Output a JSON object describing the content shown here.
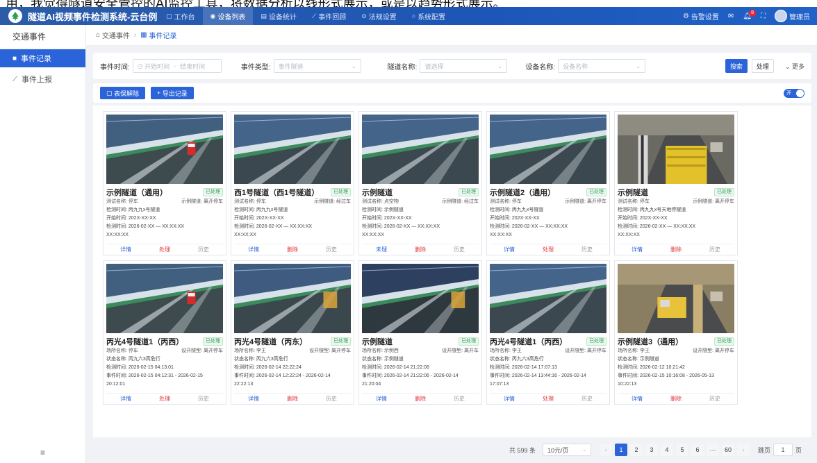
{
  "caption": "用，我觉得隧道安全管控的AI监控工具，将数据分析以线形式展示，或是以趋势形式展示。",
  "header": {
    "title": "隧道AI视频事件检测系统-云台例",
    "nav": [
      {
        "icon": "▢",
        "label": "工作台"
      },
      {
        "icon": "◉",
        "label": "设备列表"
      },
      {
        "icon": "▤",
        "label": "设备统计"
      },
      {
        "icon": "⟋",
        "label": "事件回顾"
      },
      {
        "icon": "⊙",
        "label": "法规设置"
      },
      {
        "icon": "○",
        "label": "系统配置"
      }
    ],
    "right": {
      "settings": "告警设置",
      "mail_icon": "mail-icon",
      "bell_badge": "8",
      "user": "管理员"
    }
  },
  "sidebar": {
    "title": "交通事件",
    "items": [
      {
        "label": "事件记录"
      },
      {
        "label": "事件上报"
      }
    ],
    "collapse": "≡"
  },
  "breadcrumb": {
    "home": "交通事件",
    "current": "事件记录"
  },
  "filter": {
    "time_label": "事件时间:",
    "time_start": "开始时间",
    "time_sep": "-",
    "time_end": "结束时间",
    "type_label": "事件类型:",
    "type_placeholder": "事件隧道",
    "tunnel_label": "隧道名称:",
    "tunnel_placeholder": "请选择",
    "device_label": "设备名称:",
    "device_placeholder": "设备名称",
    "search": "搜索",
    "reset": "处理",
    "more": "更多"
  },
  "toolbar": {
    "btn1": "表保解除",
    "btn2": "导出记录",
    "toggle": "开"
  },
  "cards": [
    {
      "title": "示例隧道（通用）",
      "status": "已处理",
      "a_k": "测试名称: 停车",
      "a_v": "示例隧道: 离开停车",
      "r1": "检测时间: 丙九九x号隧道",
      "r2": "开始时间: 202X-XX-XX",
      "r3": "检测时间: 2026-02-XX — XX:XX:XX",
      "r4": "XX:XX:XX",
      "acts": [
        [
          "详情",
          "blue"
        ],
        [
          "处理",
          "red"
        ],
        [
          "历史",
          "gray"
        ]
      ],
      "scene": "car"
    },
    {
      "title": "西1号隧道（西1号隧道）",
      "status": "已处理",
      "a_k": "测试名称: 停车",
      "a_v": "示例隧道: 经过车",
      "r1": "检测时间: 丙九九x号隧道",
      "r2": "开始时间: 202X-XX-XX",
      "r3": "检测时间: 2026-02-XX — XX:XX:XX",
      "r4": "XX:XX:XX",
      "acts": [
        [
          "详情",
          "blue"
        ],
        [
          "删除",
          "red"
        ],
        [
          "历史",
          "gray"
        ]
      ],
      "scene": "empty"
    },
    {
      "title": "示例隧道",
      "status": "已处理",
      "a_k": "测试名称: 点空物",
      "a_v": "示例隧道: 经过车",
      "r1": "检测时间: 示例隧道",
      "r2": "开始时间: 202X-XX-XX",
      "r3": "检测时间: 2026-02-XX — XX:XX:XX",
      "r4": "XX:XX:XX",
      "acts": [
        [
          "未理",
          "blue"
        ],
        [
          "删除",
          "red"
        ],
        [
          "历史",
          "gray"
        ]
      ],
      "scene": "empty"
    },
    {
      "title": "示例隧道2（通用）",
      "status": "已处理",
      "a_k": "测试名称: 停车",
      "a_v": "示例隧道: 离开停车",
      "r1": "检测时间: 丙九九x号隧道",
      "r2": "开始时间: 202X-XX-XX",
      "r3": "检测时间: 2026-02-XX — XX:XX:XX",
      "r4": "XX:XX:XX",
      "acts": [
        [
          "详情",
          "blue"
        ],
        [
          "处理",
          "red"
        ],
        [
          "历史",
          "gray"
        ]
      ],
      "scene": "empty"
    },
    {
      "title": "示例隧道",
      "status": "已处理",
      "a_k": "测试名称: 停车",
      "a_v": "示例隧道: 离开停车",
      "r1": "检测时间: 丙九九x号天地停隧道",
      "r2": "开始时间: 202X-XX-XX",
      "r3": "检测时间: 2026-02-XX — XX:XX:XX",
      "r4": "XX:XX:XX",
      "acts": [
        [
          "详情",
          "blue"
        ],
        [
          "删除",
          "red"
        ],
        [
          "历史",
          "gray"
        ]
      ],
      "scene": "construction"
    },
    {
      "title": "丙光4号隧道1（丙西）",
      "status": "已处理",
      "a_k": "场所名称: 停车",
      "a_v": "设开隧型: 离开停车",
      "r1": "状态名称: 丙九六3高危行",
      "r2": "检测时间: 2026-02-15 04:13:01",
      "r3": "事件时间: 2026-02-15 04:12:31 - 2026-02-15",
      "r4": "20:12:01",
      "acts": [
        [
          "详情",
          "blue"
        ],
        [
          "处理",
          "red"
        ],
        [
          "历史",
          "gray"
        ]
      ],
      "scene": "car"
    },
    {
      "title": "丙光4号隧道（丙东）",
      "status": "已处理",
      "a_k": "场所名称: 李王",
      "a_v": "设开隧型: 离开停车",
      "r1": "状态名称: 丙九六3高危行",
      "r2": "检测时间: 2026-02-14 22:22:24",
      "r3": "事件时间: 2026-02-14 12:22:24 - 2026-02-14",
      "r4": "22:22:13",
      "acts": [
        [
          "详情",
          "blue"
        ],
        [
          "删除",
          "red"
        ],
        [
          "历史",
          "gray"
        ]
      ],
      "scene": "truck"
    },
    {
      "title": "示例隧道",
      "status": "已处理",
      "a_k": "场所名称: 示例西",
      "a_v": "设开隧型: 离开车",
      "r1": "状态名称: 示例隧道",
      "r2": "检测时间: 2026-02-14 21:22:06",
      "r3": "事件时间: 2026-02-14 21:22:06 - 2026-02-14",
      "r4": "21:20:04",
      "acts": [
        [
          "详情",
          "blue"
        ],
        [
          "删除",
          "red"
        ],
        [
          "历史",
          "gray"
        ]
      ],
      "scene": "dark"
    },
    {
      "title": "丙光4号隧道1（丙西）",
      "status": "已处理",
      "a_k": "场所名称: 李王",
      "a_v": "设开隧型: 离开停车",
      "r1": "状态名称: 丙九六3高危行",
      "r2": "检测时间: 2026-02-14 17:07:13",
      "r3": "事件时间: 2026-02-14 13:44:16 - 2026-02-14",
      "r4": "17:07:13",
      "acts": [
        [
          "详情",
          "blue"
        ],
        [
          "处理",
          "red"
        ],
        [
          "历史",
          "gray"
        ]
      ],
      "scene": "empty"
    },
    {
      "title": "示例隧道3（通用）",
      "status": "已处理",
      "a_k": "场所名称: 李王",
      "a_v": "设开隧型: 离开停车",
      "r1": "状态名称: 示例隧道",
      "r2": "检测时间: 2026-02-12 10:21:42",
      "r3": "事件时间: 2026-02-15 10:16:08 - 2026-05-13",
      "r4": "10:22:13",
      "acts": [
        [
          "详情",
          "blue"
        ],
        [
          "删除",
          "red"
        ],
        [
          "历史",
          "gray"
        ]
      ],
      "scene": "construction2"
    }
  ],
  "pager": {
    "total": "共 599 条",
    "size": "10元/页",
    "prev": "‹",
    "pages": [
      "1",
      "2",
      "3",
      "4",
      "5",
      "6",
      "···",
      "60"
    ],
    "next": "›",
    "jump_label": "跳页",
    "jump_value": "1",
    "jump_unit": "页"
  }
}
